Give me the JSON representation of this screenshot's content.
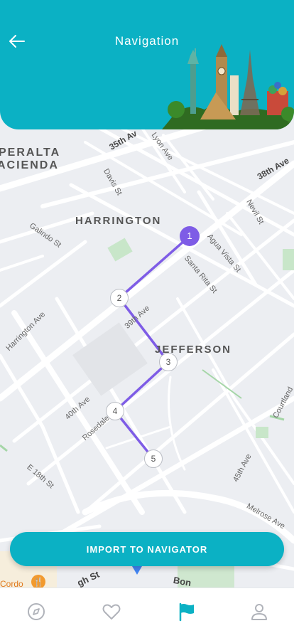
{
  "header": {
    "title": "Navigation",
    "background_color": "#0bb1c4",
    "back_icon": "arrow-left-icon",
    "image_icon": "world-landmarks-illustration"
  },
  "map": {
    "areas": [
      "PERALTA",
      "ACIENDA",
      "HARRINGTON",
      "JEFFERSON"
    ],
    "streets": [
      "35th Av",
      "Lyon Ave",
      "38th Ave",
      "Davis St",
      "Nevil St",
      "Galindo St",
      "Agua Vista St",
      "Santa Rita St",
      "Harrington Ave",
      "39th Ave",
      "40th Ave",
      "Rosedale",
      "E 18th St",
      "45th Ave",
      "Courtland",
      "Melrose Ave",
      "Bon",
      "gh St",
      "Cordo"
    ],
    "route_color": "#7e5ce6",
    "stops": [
      "1",
      "2",
      "3",
      "4",
      "5"
    ],
    "active_stop": "1"
  },
  "cta": {
    "label": "IMPORT TO NAVIGATOR"
  },
  "tabbar": {
    "items": [
      {
        "icon": "compass-icon",
        "active": false
      },
      {
        "icon": "heart-icon",
        "active": false
      },
      {
        "icon": "flag-icon",
        "active": true
      },
      {
        "icon": "user-icon",
        "active": false
      }
    ]
  }
}
